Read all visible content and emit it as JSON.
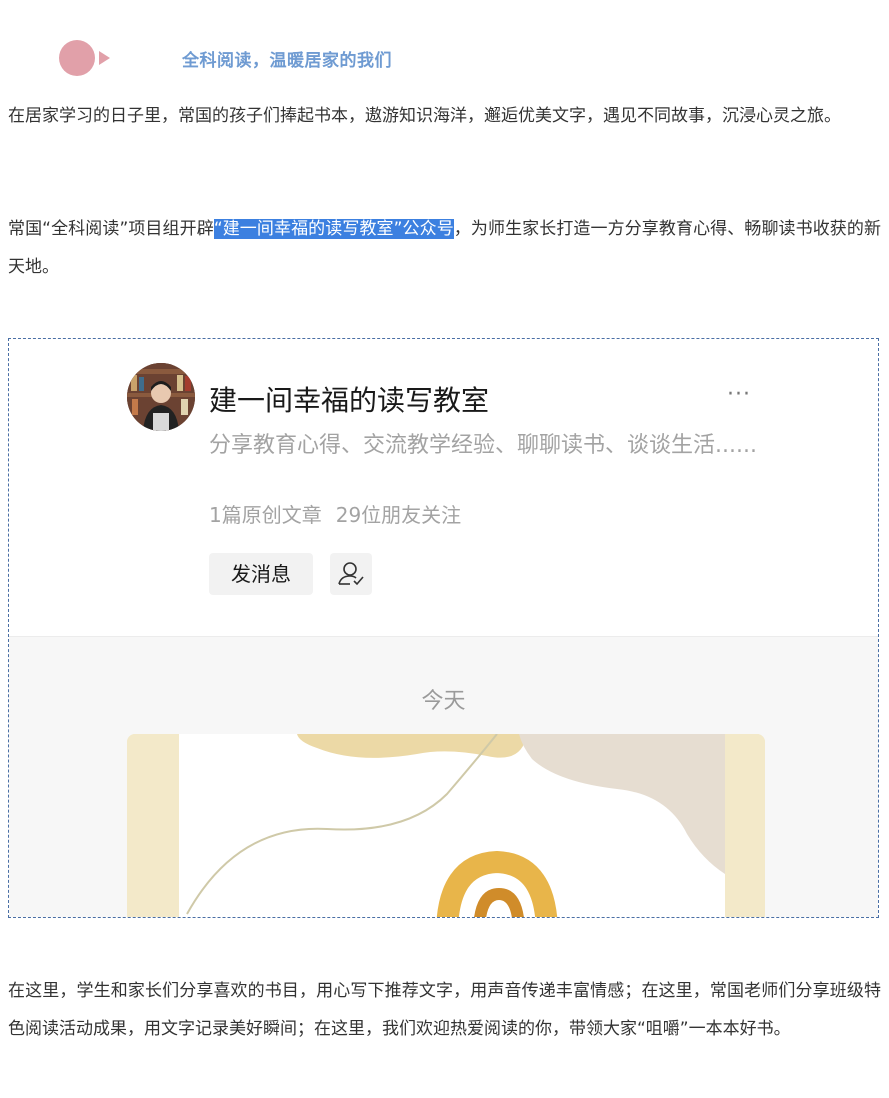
{
  "header": {
    "title": "全科阅读，温暖居家的我们"
  },
  "paragraphs": {
    "p1": "在居家学习的日子里，常国的孩子们捧起书本，遨游知识海洋，邂逅优美文字，遇见不同故事，沉浸心灵之旅。",
    "p2_before": "常国“全科阅读”项目组开辟",
    "p2_highlight": "“建一间幸福的读写教室”公众号",
    "p2_after": "，为师生家长打造一方分享教育心得、畅聊读书收获的新天地。",
    "p3": "在这里，学生和家长们分享喜欢的书目，用心写下推荐文字，用声音传递丰富情感；在这里，常国老师们分享班级特色阅读活动成果，用文字记录美好瞬间；在这里，我们欢迎热爱阅读的你，带领大家“咀嚼”一本本好书。"
  },
  "account": {
    "name": "建一间幸福的读写教室",
    "more": "···",
    "description": "分享教育心得、交流教学经验、聊聊读书、谈谈生活......",
    "articles": "1篇原创文章",
    "followers": "29位朋友关注",
    "message_button": "发消息",
    "follow_icon": "user-check-icon"
  },
  "feed": {
    "date_label": "今天"
  },
  "colors": {
    "accent_pink": "#e1a0a9",
    "title_blue": "#6f9bd2",
    "highlight": "#3c80e0",
    "card_beige": "#f3e9c9",
    "swirl_gold": "#e8b54a"
  }
}
